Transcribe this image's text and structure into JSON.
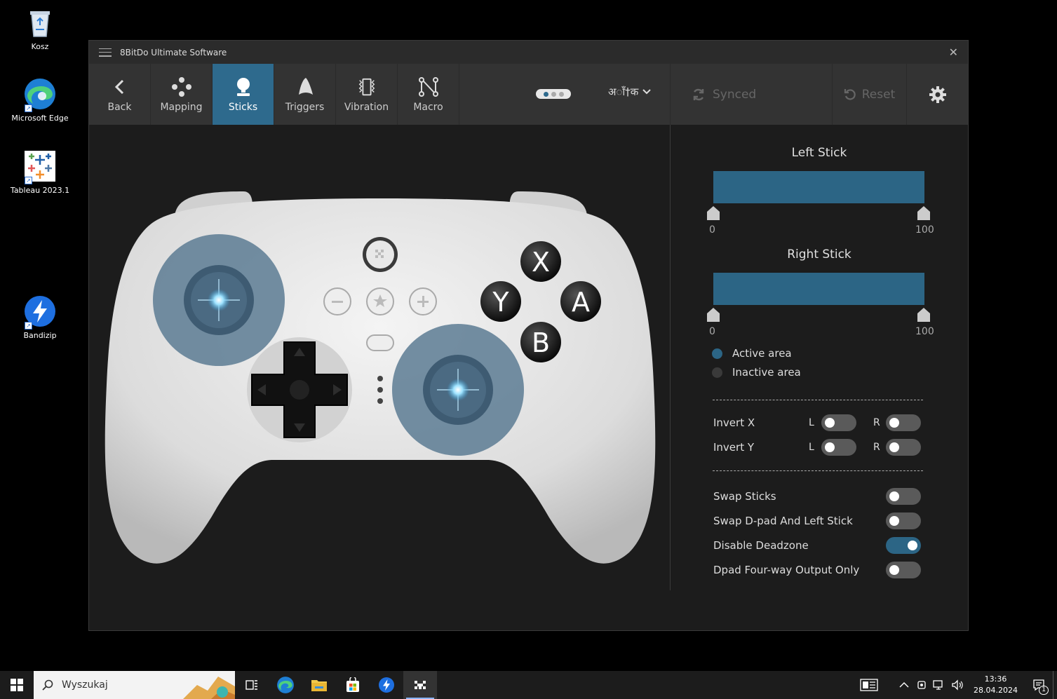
{
  "desktop": {
    "icons": [
      {
        "label": "Kosz"
      },
      {
        "label": "Microsoft Edge"
      },
      {
        "label": "Tableau 2023.1"
      },
      {
        "label": "Bandizip"
      }
    ]
  },
  "window": {
    "title": "8BitDo Ultimate Software",
    "close": "✕"
  },
  "toolbar": {
    "tabs": [
      {
        "label": "Back"
      },
      {
        "label": "Mapping"
      },
      {
        "label": "Sticks"
      },
      {
        "label": "Triggers"
      },
      {
        "label": "Vibration"
      },
      {
        "label": "Macro"
      }
    ],
    "language": "अाँ†क",
    "synced": "Synced",
    "reset": "Reset"
  },
  "controller": {
    "buttons": {
      "x": "X",
      "y": "Y",
      "a": "A",
      "b": "B"
    }
  },
  "panel": {
    "left_stick": {
      "title": "Left Stick",
      "min": "0",
      "max": "100",
      "range_start": 0,
      "range_end": 100
    },
    "right_stick": {
      "title": "Right Stick",
      "min": "0",
      "max": "100",
      "range_start": 0,
      "range_end": 100
    },
    "legend": {
      "active": "Active area",
      "inactive": "Inactive area",
      "active_color": "#2c6585",
      "inactive_color": "#3a3a3a"
    },
    "invert_x": {
      "label": "Invert X",
      "l": "L",
      "r": "R",
      "l_on": false,
      "r_on": false
    },
    "invert_y": {
      "label": "Invert Y",
      "l": "L",
      "r": "R",
      "l_on": false,
      "r_on": false
    },
    "options": [
      {
        "label": "Swap Sticks",
        "on": false
      },
      {
        "label": "Swap D-pad And Left Stick",
        "on": false
      },
      {
        "label": "Disable Deadzone",
        "on": true
      },
      {
        "label": "Dpad Four-way Output Only",
        "on": false
      }
    ]
  },
  "taskbar": {
    "search_placeholder": "Wyszukaj",
    "time": "13:36",
    "date": "28.04.2024",
    "notifications": "1"
  }
}
